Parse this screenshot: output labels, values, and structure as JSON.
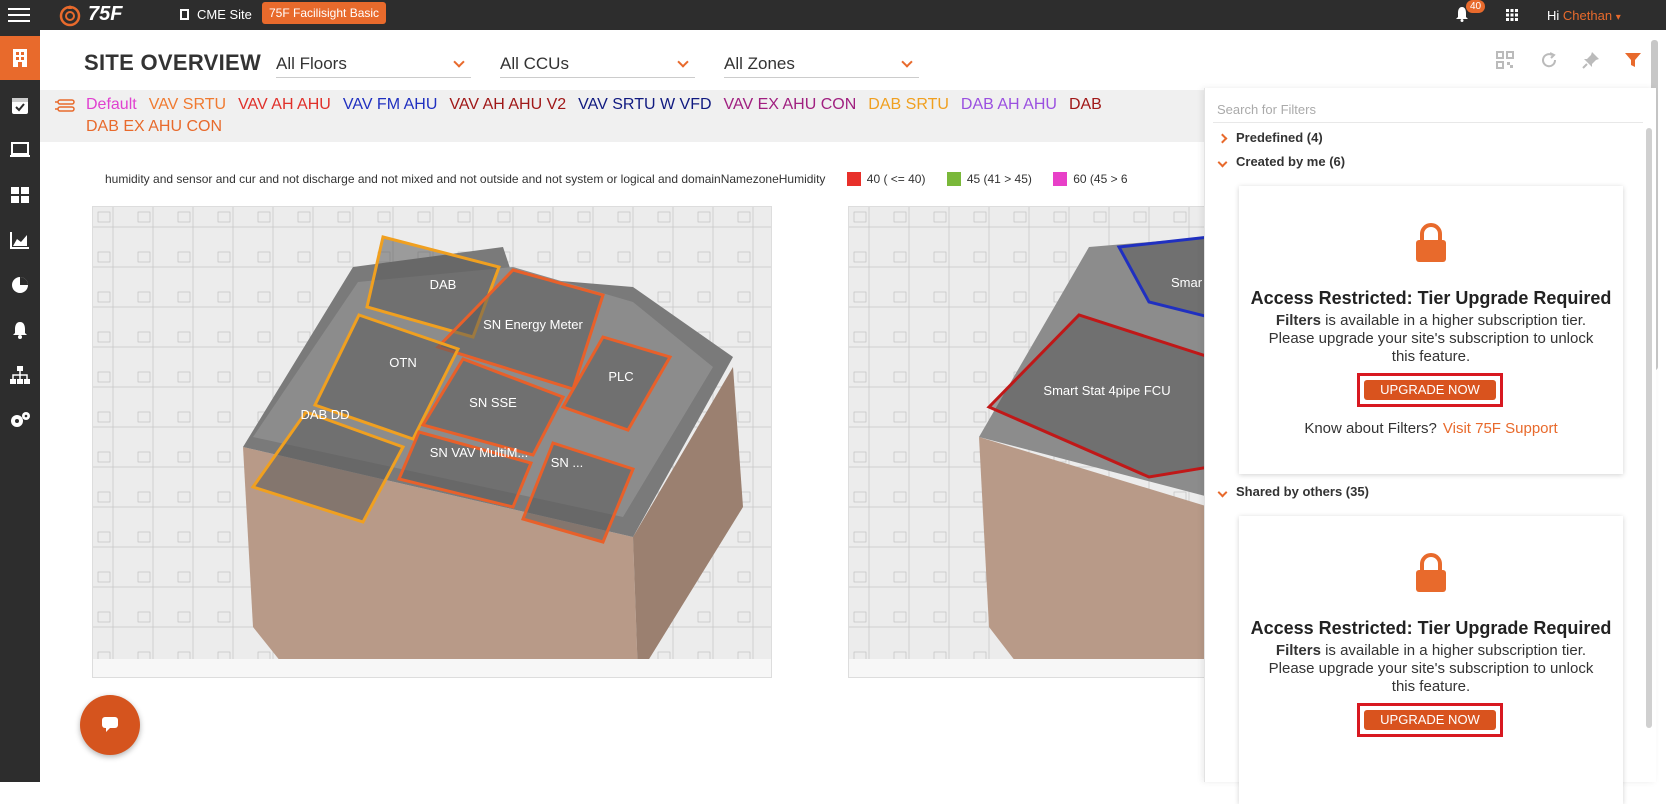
{
  "topbar": {
    "logo_text": "75F",
    "site_name": "CME Site",
    "tier_badge": "75F Facilisight Basic",
    "notification_count": "40",
    "greeting": "Hi",
    "user_name": "Chethan"
  },
  "header": {
    "title": "SITE OVERVIEW",
    "floors_select": "All Floors",
    "ccus_select": "All CCUs",
    "zones_select": "All Zones"
  },
  "categories": [
    {
      "label": "Default",
      "color": "#e040d0"
    },
    {
      "label": "VAV SRTU",
      "color": "#f07a30"
    },
    {
      "label": "VAV AH AHU",
      "color": "#e0302a"
    },
    {
      "label": "VAV FM AHU",
      "color": "#2030c0"
    },
    {
      "label": "VAV AH AHU V2",
      "color": "#a01818"
    },
    {
      "label": "VAV SRTU W VFD",
      "color": "#101a80"
    },
    {
      "label": "VAV EX AHU CON",
      "color": "#a02080"
    },
    {
      "label": "DAB SRTU",
      "color": "#f0a020"
    },
    {
      "label": "DAB AH AHU",
      "color": "#9a50e0"
    },
    {
      "label": "DAB",
      "color": "#a01818"
    },
    {
      "label": "DAB EX AHU CON",
      "color": "#e86a2c"
    }
  ],
  "filter_query": "humidity and sensor and cur and not discharge and not mixed and not outside and not system or logical and domainNamezoneHumidity",
  "humidity_legend": [
    {
      "label": "40 ( <= 40)",
      "color": "#e8302a"
    },
    {
      "label": "45 (41 > 45)",
      "color": "#7ab83a"
    },
    {
      "label": "60 (45 > 6",
      "color": "#e840c8"
    }
  ],
  "floorplan_left": {
    "zones": [
      {
        "label": "DAB"
      },
      {
        "label": "SN Energy Meter"
      },
      {
        "label": "OTN"
      },
      {
        "label": "PLC"
      },
      {
        "label": "SN SSE"
      },
      {
        "label": "DAB DD"
      },
      {
        "label": "SN VAV MultiM..."
      },
      {
        "label": "SN ..."
      }
    ]
  },
  "floorplan_right": {
    "zones": [
      {
        "label": "Smar"
      },
      {
        "label": "Smart Stat 4pipe FCU"
      }
    ]
  },
  "filter_panel": {
    "search_placeholder": "Search for Filters",
    "predefined": "Predefined (4)",
    "created_by_me": "Created by me (6)",
    "shared_by_others": "Shared by others (35)",
    "card": {
      "title": "Access Restricted: Tier Upgrade Required",
      "desc_strong": "Filters",
      "desc_rest": " is available in a higher subscription tier. Please upgrade your site's subscription to unlock this feature.",
      "button": "UPGRADE NOW",
      "know_text": "Know about Filters?",
      "support_link": "Visit 75F Support"
    }
  }
}
